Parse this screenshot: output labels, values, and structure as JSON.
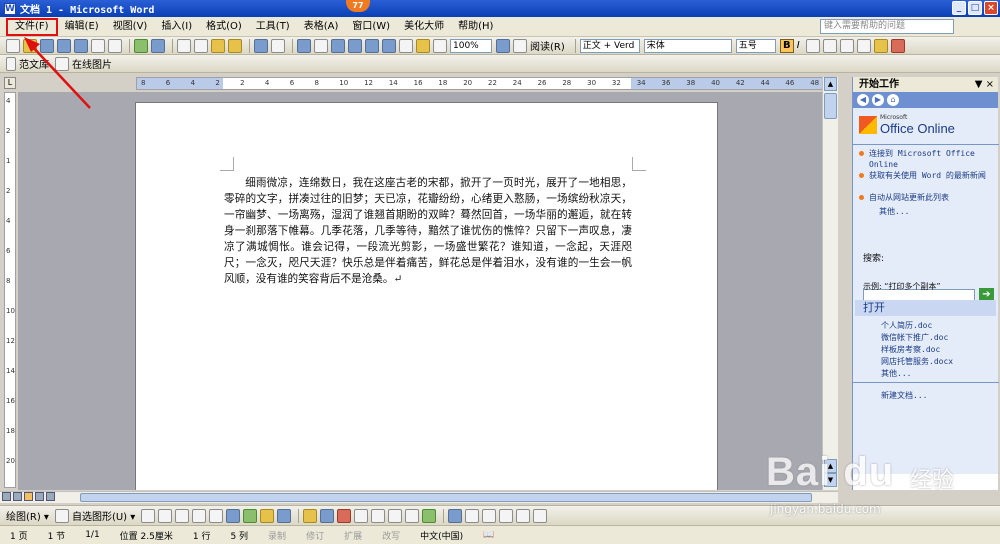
{
  "titlebar": {
    "title": "文档 1 - Microsoft Word",
    "badge": "77"
  },
  "menubar": {
    "items": [
      "文件(F)",
      "编辑(E)",
      "视图(V)",
      "插入(I)",
      "格式(O)",
      "工具(T)",
      "表格(A)",
      "窗口(W)",
      "美化大师",
      "帮助(H)"
    ],
    "help_placeholder": "键入需要帮助的问题"
  },
  "toolbar": {
    "zoom": "100%",
    "read_label": "阅读(R)",
    "style": "正文 + Verd",
    "font": "宋体",
    "size": "五号",
    "bold": "B",
    "italic": "I"
  },
  "toolbar2": {
    "fan_label": "范文库",
    "online_label": "在线图片"
  },
  "document": {
    "body": "细雨微凉，连绵数日，我在这座古老的宋都，掀开了一页时光，展开了一地相思，零碎的文字，拼凑过往的旧梦；天已凉，花瓣纷纷，心绪更入憝肠，一场缤纷秋凉天，一帘幽梦、一场离殇，湿润了谁翘首期盼的双眸？蓦然回首，一场华丽的邂逅，就在转身一刹那落下帷幕。几季花落，几季等待，黯然了谁忧伤的憔悴？只留下一声叹息，凄凉了满城惆怅。谁会记得，一段流光剪影，一场盛世繁花？谁知道，一念起，天涯咫尺；一念灭，咫尺天涯？快乐总是伴着痛苦，鲜花总是伴着泪水，没有谁的一生会一帆风顺，没有谁的笑容背后不是沧桑。↵"
  },
  "ruler": {
    "h_marks": [
      "8",
      "6",
      "4",
      "2",
      "2",
      "4",
      "6",
      "8",
      "10",
      "12",
      "14",
      "16",
      "18",
      "20",
      "22",
      "24",
      "26",
      "28",
      "30",
      "32",
      "34",
      "36",
      "38",
      "40",
      "42",
      "44",
      "46",
      "48"
    ],
    "v_marks": [
      "4",
      "2",
      "1",
      "2",
      "4",
      "6",
      "8",
      "10",
      "12",
      "14",
      "16",
      "18",
      "20"
    ]
  },
  "taskpane": {
    "title": "开始工作",
    "close": "▼ ×",
    "logo_ms": "Microsoft",
    "logo_text": "Office Online",
    "links": [
      "连接到 Microsoft Office Online",
      "获取有关使用 Word 的最新新闻",
      "自动从网站更新此列表"
    ],
    "more": "其他...",
    "search_label": "搜索:",
    "example_label": "示例: “打印多个副本”",
    "open_section": "打开",
    "files": [
      "个人简历.doc",
      "微信帐下推广.doc",
      "样板房考察.doc",
      "网店托管服务.docx"
    ],
    "files_more": "其他...",
    "new_doc": "新建文档..."
  },
  "drawbar": {
    "draw_label": "绘图(R) ▾",
    "autoshape_label": "自选图形(U) ▾"
  },
  "statusbar": {
    "page": "1 页",
    "section": "1 节",
    "pages": "1/1",
    "position": "位置 2.5厘米",
    "line": "1 行",
    "col": "5 列",
    "rec": "录制",
    "trk": "修订",
    "ext": "扩展",
    "ovr": "改写",
    "lang": "中文(中国)"
  },
  "watermark": {
    "brand": "Bai du",
    "cn": "经验",
    "url": "jingyan.baidu.com"
  },
  "colors": {
    "title_blue": "#0a3fb5",
    "highlight_red": "#e01010",
    "taskpane_blue": "#e5ecf9"
  }
}
